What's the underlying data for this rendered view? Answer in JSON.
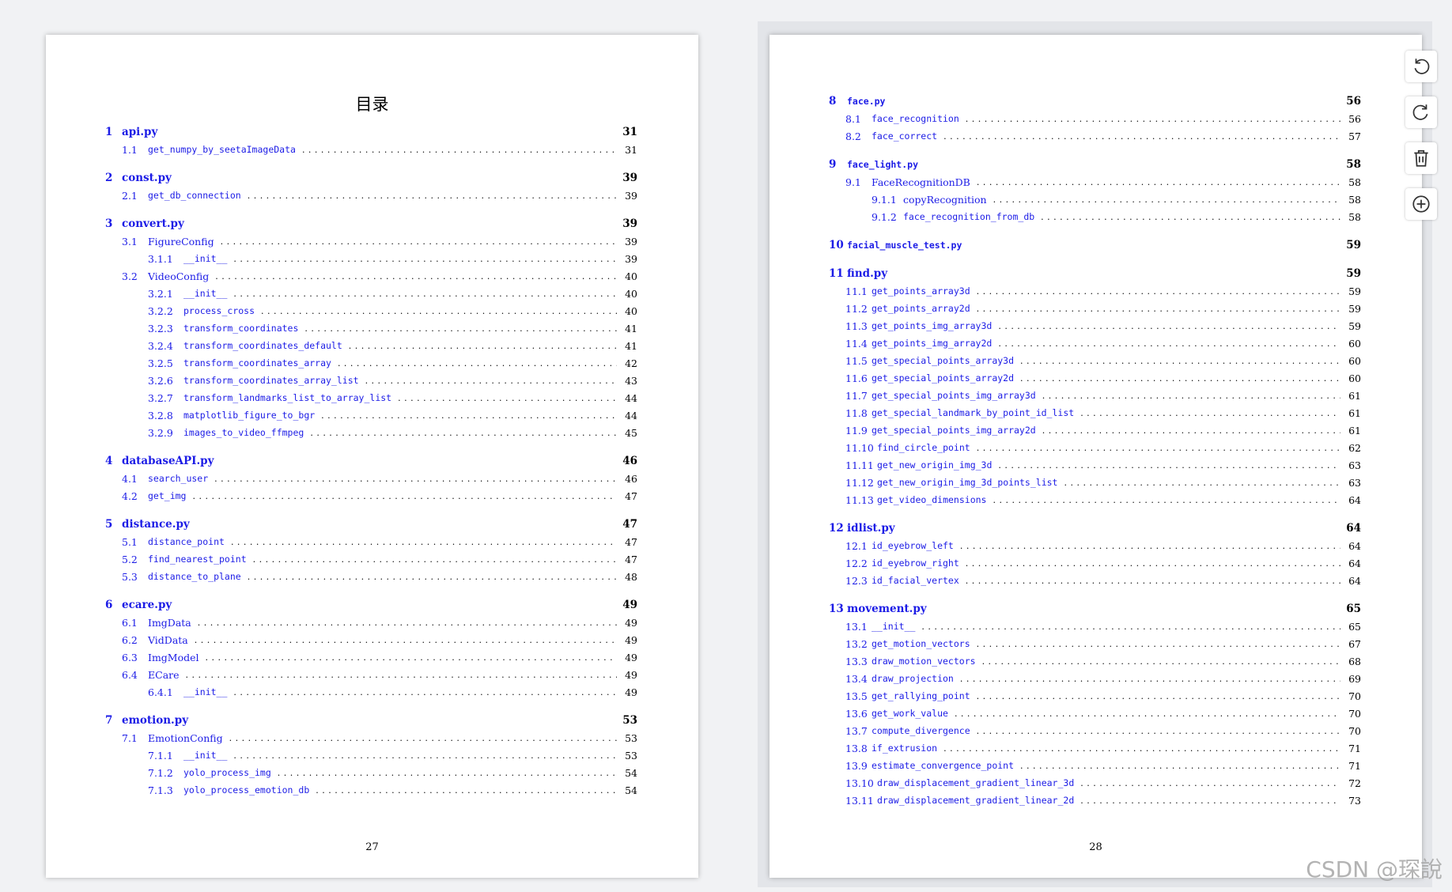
{
  "left_page": {
    "title": "目录",
    "page_number": "27",
    "entries": [
      {
        "level": 1,
        "num": "1",
        "title": "api.py",
        "page": "31"
      },
      {
        "level": 2,
        "num": "1.1",
        "title": "get_numpy_by_seetaImageData",
        "page": "31",
        "mono": true
      },
      {
        "level": 1,
        "num": "2",
        "title": "const.py",
        "page": "39"
      },
      {
        "level": 2,
        "num": "2.1",
        "title": "get_db_connection",
        "page": "39",
        "mono": true
      },
      {
        "level": 1,
        "num": "3",
        "title": "convert.py",
        "page": "39"
      },
      {
        "level": 2,
        "num": "3.1",
        "title": "FigureConfig",
        "page": "39"
      },
      {
        "level": 3,
        "num": "3.1.1",
        "title": "__init__",
        "page": "39",
        "mono": true
      },
      {
        "level": 2,
        "num": "3.2",
        "title": "VideoConfig",
        "page": "40"
      },
      {
        "level": 3,
        "num": "3.2.1",
        "title": "__init__",
        "page": "40",
        "mono": true
      },
      {
        "level": 3,
        "num": "3.2.2",
        "title": "process_cross",
        "page": "40",
        "mono": true
      },
      {
        "level": 3,
        "num": "3.2.3",
        "title": "transform_coordinates",
        "page": "41",
        "mono": true
      },
      {
        "level": 3,
        "num": "3.2.4",
        "title": "transform_coordinates_default",
        "page": "41",
        "mono": true
      },
      {
        "level": 3,
        "num": "3.2.5",
        "title": "transform_coordinates_array",
        "page": "42",
        "mono": true
      },
      {
        "level": 3,
        "num": "3.2.6",
        "title": "transform_coordinates_array_list",
        "page": "43",
        "mono": true
      },
      {
        "level": 3,
        "num": "3.2.7",
        "title": "transform_landmarks_list_to_array_list",
        "page": "44",
        "mono": true
      },
      {
        "level": 3,
        "num": "3.2.8",
        "title": "matplotlib_figure_to_bgr",
        "page": "44",
        "mono": true
      },
      {
        "level": 3,
        "num": "3.2.9",
        "title": "images_to_video_ffmpeg",
        "page": "45",
        "mono": true
      },
      {
        "level": 1,
        "num": "4",
        "title": "databaseAPI.py",
        "page": "46"
      },
      {
        "level": 2,
        "num": "4.1",
        "title": "search_user",
        "page": "46",
        "mono": true
      },
      {
        "level": 2,
        "num": "4.2",
        "title": "get_img",
        "page": "47",
        "mono": true
      },
      {
        "level": 1,
        "num": "5",
        "title": "distance.py",
        "page": "47"
      },
      {
        "level": 2,
        "num": "5.1",
        "title": "distance_point",
        "page": "47",
        "mono": true
      },
      {
        "level": 2,
        "num": "5.2",
        "title": "find_nearest_point",
        "page": "47",
        "mono": true
      },
      {
        "level": 2,
        "num": "5.3",
        "title": "distance_to_plane",
        "page": "48",
        "mono": true
      },
      {
        "level": 1,
        "num": "6",
        "title": "ecare.py",
        "page": "49"
      },
      {
        "level": 2,
        "num": "6.1",
        "title": "ImgData",
        "page": "49"
      },
      {
        "level": 2,
        "num": "6.2",
        "title": "VidData",
        "page": "49"
      },
      {
        "level": 2,
        "num": "6.3",
        "title": "ImgModel",
        "page": "49"
      },
      {
        "level": 2,
        "num": "6.4",
        "title": "ECare",
        "page": "49"
      },
      {
        "level": 3,
        "num": "6.4.1",
        "title": "__init__",
        "page": "49",
        "mono": true
      },
      {
        "level": 1,
        "num": "7",
        "title": "emotion.py",
        "page": "53"
      },
      {
        "level": 2,
        "num": "7.1",
        "title": "EmotionConfig",
        "page": "53"
      },
      {
        "level": 3,
        "num": "7.1.1",
        "title": "__init__",
        "page": "53",
        "mono": true
      },
      {
        "level": 3,
        "num": "7.1.2",
        "title": "yolo_process_img",
        "page": "54",
        "mono": true
      },
      {
        "level": 3,
        "num": "7.1.3",
        "title": "yolo_process_emotion_db",
        "page": "54",
        "mono": true
      }
    ]
  },
  "right_page": {
    "page_number": "28",
    "entries": [
      {
        "level": 1,
        "num": "8",
        "title": "face.py",
        "page": "56",
        "mono": true
      },
      {
        "level": 2,
        "num": "8.1",
        "title": "face_recognition",
        "page": "56",
        "mono": true
      },
      {
        "level": 2,
        "num": "8.2",
        "title": "face_correct",
        "page": "57",
        "mono": true
      },
      {
        "level": 1,
        "num": "9",
        "title": "face_light.py",
        "page": "58",
        "mono": true
      },
      {
        "level": 2,
        "num": "9.1",
        "title": "FaceRecognitionDB",
        "page": "58"
      },
      {
        "level": 3,
        "num": "9.1.1",
        "title": "copyRecognition",
        "page": "58"
      },
      {
        "level": 3,
        "num": "9.1.2",
        "title": "face_recognition_from_db",
        "page": "58",
        "mono": true
      },
      {
        "level": 1,
        "num": "10",
        "title": "facial_muscle_test.py",
        "page": "59",
        "mono": true,
        "noleader": true
      },
      {
        "level": 1,
        "num": "11",
        "title": "find.py",
        "page": "59"
      },
      {
        "level": 2,
        "num": "11.1",
        "title": "get_points_array3d",
        "page": "59",
        "mono": true
      },
      {
        "level": 2,
        "num": "11.2",
        "title": "get_points_array2d",
        "page": "59",
        "mono": true
      },
      {
        "level": 2,
        "num": "11.3",
        "title": "get_points_img_array3d",
        "page": "59",
        "mono": true
      },
      {
        "level": 2,
        "num": "11.4",
        "title": "get_points_img_array2d",
        "page": "60",
        "mono": true
      },
      {
        "level": 2,
        "num": "11.5",
        "title": "get_special_points_array3d",
        "page": "60",
        "mono": true
      },
      {
        "level": 2,
        "num": "11.6",
        "title": "get_special_points_array2d",
        "page": "60",
        "mono": true
      },
      {
        "level": 2,
        "num": "11.7",
        "title": "get_special_points_img_array3d",
        "page": "61",
        "mono": true
      },
      {
        "level": 2,
        "num": "11.8",
        "title": "get_special_landmark_by_point_id_list",
        "page": "61",
        "mono": true
      },
      {
        "level": 2,
        "num": "11.9",
        "title": "get_special_points_img_array2d",
        "page": "61",
        "mono": true
      },
      {
        "level": 2,
        "num": "11.10",
        "title": "find_circle_point",
        "page": "62",
        "mono": true
      },
      {
        "level": 2,
        "num": "11.11",
        "title": "get_new_origin_img_3d",
        "page": "63",
        "mono": true
      },
      {
        "level": 2,
        "num": "11.12",
        "title": "get_new_origin_img_3d_points_list",
        "page": "63",
        "mono": true
      },
      {
        "level": 2,
        "num": "11.13",
        "title": "get_video_dimensions",
        "page": "64",
        "mono": true
      },
      {
        "level": 1,
        "num": "12",
        "title": "idlist.py",
        "page": "64"
      },
      {
        "level": 2,
        "num": "12.1",
        "title": "id_eyebrow_left",
        "page": "64",
        "mono": true
      },
      {
        "level": 2,
        "num": "12.2",
        "title": "id_eyebrow_right",
        "page": "64",
        "mono": true
      },
      {
        "level": 2,
        "num": "12.3",
        "title": "id_facial_vertex",
        "page": "64",
        "mono": true
      },
      {
        "level": 1,
        "num": "13",
        "title": "movement.py",
        "page": "65"
      },
      {
        "level": 2,
        "num": "13.1",
        "title": "__init__",
        "page": "65",
        "mono": true
      },
      {
        "level": 2,
        "num": "13.2",
        "title": "get_motion_vectors",
        "page": "67",
        "mono": true
      },
      {
        "level": 2,
        "num": "13.3",
        "title": "draw_motion_vectors",
        "page": "68",
        "mono": true
      },
      {
        "level": 2,
        "num": "13.4",
        "title": "draw_projection",
        "page": "69",
        "mono": true
      },
      {
        "level": 2,
        "num": "13.5",
        "title": "get_rallying_point",
        "page": "70",
        "mono": true
      },
      {
        "level": 2,
        "num": "13.6",
        "title": "get_work_value",
        "page": "70",
        "mono": true
      },
      {
        "level": 2,
        "num": "13.7",
        "title": "compute_divergence",
        "page": "70",
        "mono": true
      },
      {
        "level": 2,
        "num": "13.8",
        "title": "if_extrusion",
        "page": "71",
        "mono": true
      },
      {
        "level": 2,
        "num": "13.9",
        "title": "estimate_convergence_point",
        "page": "71",
        "mono": true
      },
      {
        "level": 2,
        "num": "13.10",
        "title": "draw_displacement_gradient_linear_3d",
        "page": "72",
        "mono": true
      },
      {
        "level": 2,
        "num": "13.11",
        "title": "draw_displacement_gradient_linear_2d",
        "page": "73",
        "mono": true
      }
    ]
  },
  "toolbar": {
    "buttons": [
      {
        "name": "rotate-left-button",
        "icon": "rotate-ccw-icon"
      },
      {
        "name": "rotate-right-button",
        "icon": "rotate-cw-icon"
      },
      {
        "name": "delete-page-button",
        "icon": "trash-icon"
      },
      {
        "name": "add-page-button",
        "icon": "plus-circle-icon"
      }
    ]
  },
  "watermark": "CSDN @琛說",
  "colors": {
    "link": "#1c1ce6",
    "text": "#000000"
  }
}
